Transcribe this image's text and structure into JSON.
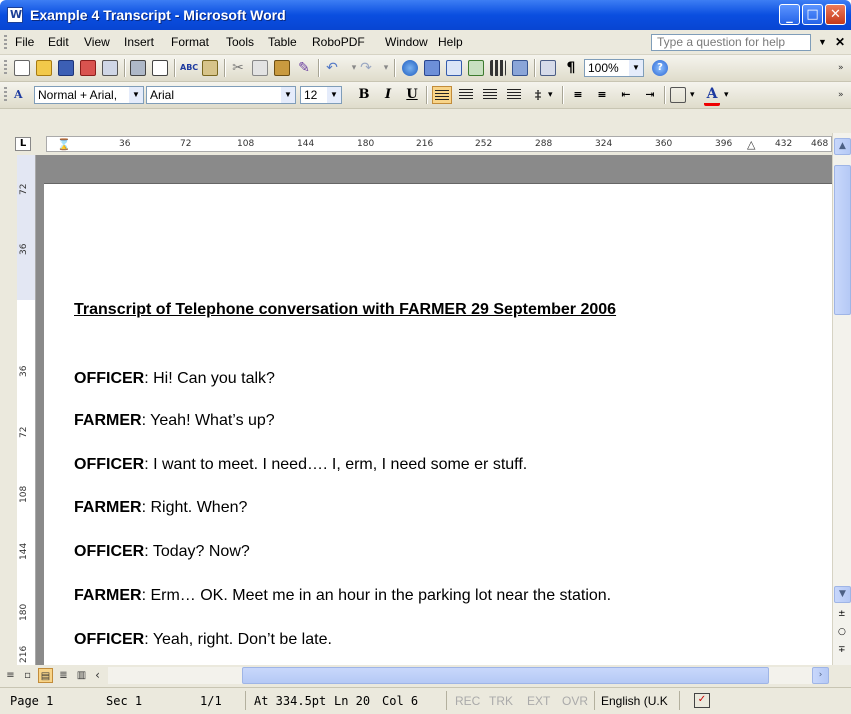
{
  "window": {
    "title": "Example 4 Transcript - Microsoft Word"
  },
  "menu": {
    "items": [
      "File",
      "Edit",
      "View",
      "Insert",
      "Format",
      "Tools",
      "Table",
      "RoboPDF",
      "Window",
      "Help"
    ],
    "ask_placeholder": "Type a question for help"
  },
  "formatting": {
    "style": "Normal + Arial,",
    "font": "Arial",
    "size": "12",
    "zoom": "100%"
  },
  "ruler": {
    "marks": [
      "36",
      "72",
      "108",
      "144",
      "180",
      "216",
      "252",
      "288",
      "324",
      "360",
      "396",
      "432",
      "468"
    ],
    "vmarks": [
      "72",
      "36",
      "36",
      "72",
      "108",
      "144",
      "180",
      "216"
    ]
  },
  "document": {
    "title": "Transcript of Telephone conversation with FARMER 29 September 2006",
    "lines": [
      {
        "speaker": "OFFICER",
        "text": ": Hi! Can you talk?"
      },
      {
        "speaker": "FARMER",
        "text": ": Yeah! What’s up?"
      },
      {
        "speaker": "OFFICER",
        "text": ": I want to meet. I need…. I, erm, I need some er stuff."
      },
      {
        "speaker": "FARMER",
        "text": ": Right. When?"
      },
      {
        "speaker": "OFFICER",
        "text": ": Today? Now?"
      },
      {
        "speaker": "FARMER",
        "text": ": Erm… OK. Meet me in an hour in the parking lot near the station."
      },
      {
        "speaker": "OFFICER",
        "text": ": Yeah, right. Don’t be late."
      }
    ]
  },
  "status": {
    "page": "Page 1",
    "section": "Sec 1",
    "pages": "1/1",
    "at": "At 334.5pt",
    "line": "Ln 20",
    "col": "Col 6",
    "rec": "REC",
    "trk": "TRK",
    "ext": "EXT",
    "ovr": "OVR",
    "language": "English (U.K"
  }
}
